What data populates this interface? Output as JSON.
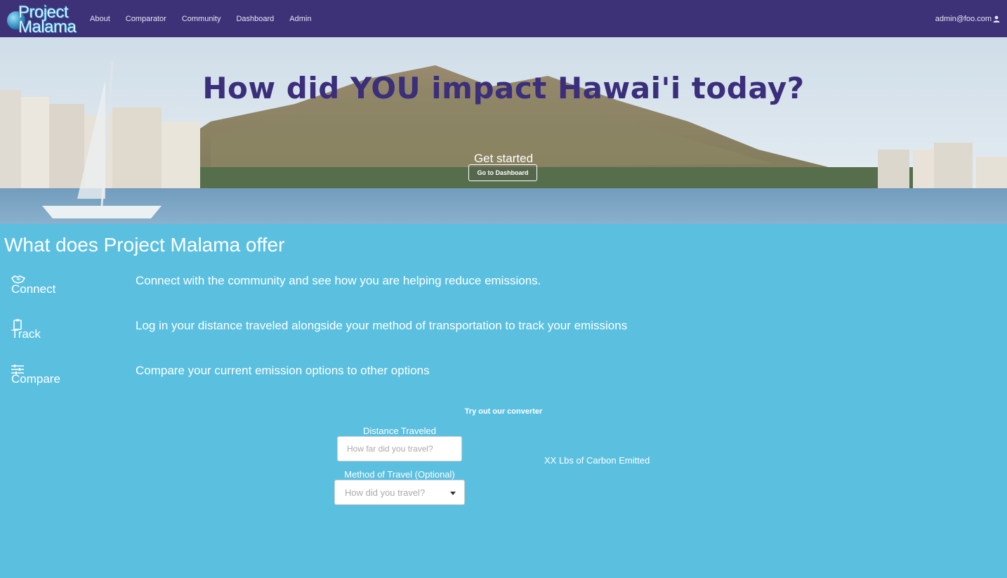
{
  "nav": {
    "logo_line1": "Project",
    "logo_line2": "Malama",
    "links": [
      "About",
      "Comparator",
      "Community",
      "Dashboard",
      "Admin"
    ],
    "user_email": "admin@foo.com",
    "user_icon": "user-icon"
  },
  "hero": {
    "title": "How did YOU impact Hawai'i today?",
    "subtitle": "Get started",
    "button_label": "Go to Dashboard"
  },
  "offer": {
    "title": "What does Project Malama offer",
    "features": [
      {
        "icon": "handshake-icon",
        "label": "Connect",
        "description": "Connect with the community and see how you are helping reduce emissions."
      },
      {
        "icon": "clipboard-icon",
        "label": "Track",
        "description": "Log in your distance traveled alongside your method of transportation to track your emissions"
      },
      {
        "icon": "sliders-icon",
        "label": "Compare",
        "description": "Compare your current emission options to other options"
      }
    ]
  },
  "converter": {
    "title": "Try out our converter",
    "distance_label": "Distance Traveled",
    "distance_placeholder": "How far did you travel?",
    "method_label": "Method of Travel (Optional)",
    "method_placeholder": "How did you travel?",
    "result_text": "XX Lbs of Carbon Emitted"
  },
  "colors": {
    "navbar": "#3d3277",
    "page_bg": "#5bc0e0",
    "hero_title": "#3b2e7a"
  }
}
